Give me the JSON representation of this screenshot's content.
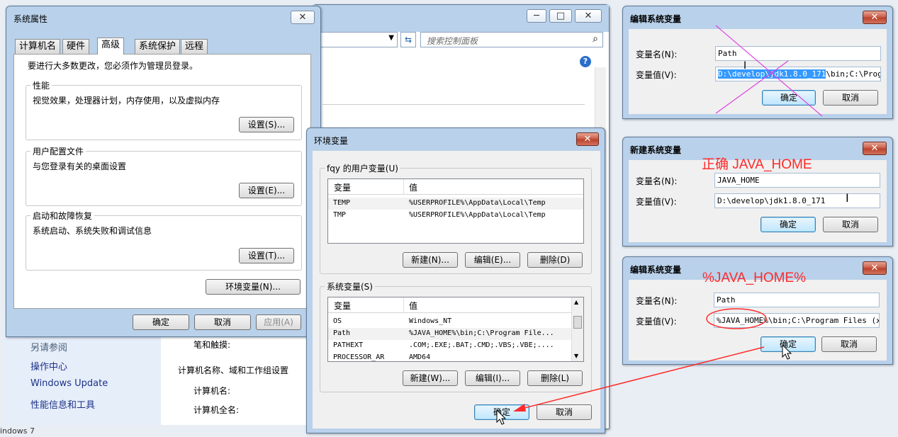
{
  "control_panel": {
    "search_placeholder": "搜索控制面板",
    "see_also": "另请参阅",
    "links": [
      "操作中心",
      "Windows Update",
      "性能信息和工具"
    ],
    "pen_touch": "笔和触摸:",
    "domain_heading": "计算机名称、域和工作组设置",
    "computer_name": "计算机名:",
    "full_computer_name": "计算机全名:",
    "bottom_text": "indows 7"
  },
  "sys_props": {
    "title": "系统属性",
    "tabs": [
      "计算机名",
      "硬件",
      "高级",
      "系统保护",
      "远程"
    ],
    "admin_note": "要进行大多数更改，您必须作为管理员登录。",
    "perf": {
      "label": "性能",
      "desc": "视觉效果，处理器计划，内存使用，以及虚拟内存",
      "button": "设置(S)..."
    },
    "profile": {
      "label": "用户配置文件",
      "desc": "与您登录有关的桌面设置",
      "button": "设置(E)..."
    },
    "startup": {
      "label": "启动和故障恢复",
      "desc": "系统启动、系统失败和调试信息",
      "button": "设置(T)..."
    },
    "env_button": "环境变量(N)...",
    "ok": "确定",
    "cancel": "取消",
    "apply": "应用(A)"
  },
  "env_vars": {
    "title": "环境变量",
    "user_group": "fqy 的用户变量(U)",
    "columns": [
      "变量",
      "值"
    ],
    "user_rows": [
      {
        "name": "TEMP",
        "value": "%USERPROFILE%\\AppData\\Local\\Temp"
      },
      {
        "name": "TMP",
        "value": "%USERPROFILE%\\AppData\\Local\\Temp"
      }
    ],
    "user_buttons": [
      "新建(N)...",
      "编辑(E)...",
      "删除(D)"
    ],
    "sys_group": "系统变量(S)",
    "sys_rows": [
      {
        "name": "OS",
        "value": "Windows_NT"
      },
      {
        "name": "Path",
        "value": "%JAVA_HOME%\\bin;C:\\Program File..."
      },
      {
        "name": "PATHEXT",
        "value": ".COM;.EXE;.BAT;.CMD;.VBS;.VBE;...."
      },
      {
        "name": "PROCESSOR_AR",
        "value": "AMD64"
      }
    ],
    "sys_buttons": [
      "新建(W)...",
      "编辑(I)...",
      "删除(L)"
    ],
    "ok": "确定",
    "cancel": "取消"
  },
  "edit1": {
    "title": "编辑系统变量",
    "name_label": "变量名(N):",
    "value_label": "变量值(V):",
    "name": "Path",
    "value_selected": "D:\\develop\\jdk1.8.0_171",
    "value_rest": "\\bin;C:\\Prog",
    "ok": "确定",
    "cancel": "取消"
  },
  "new_var": {
    "title": "新建系统变量",
    "annotation": "正确 JAVA_HOME",
    "name_label": "变量名(N):",
    "value_label": "变量值(V):",
    "name": "JAVA_HOME",
    "value": "D:\\develop\\jdk1.8.0_171",
    "ok": "确定",
    "cancel": "取消"
  },
  "edit2": {
    "title": "编辑系统变量",
    "annotation": "%JAVA_HOME%",
    "name_label": "变量名(N):",
    "value_label": "变量值(V):",
    "name": "Path",
    "value": "%JAVA_HOME%\\bin;C:\\Program Files (x8",
    "ok": "确定",
    "cancel": "取消"
  },
  "colors": {
    "annotation_red": "#ff2a2a",
    "cross_magenta": "#e040e0",
    "titlebar": "#b9d1ea"
  }
}
